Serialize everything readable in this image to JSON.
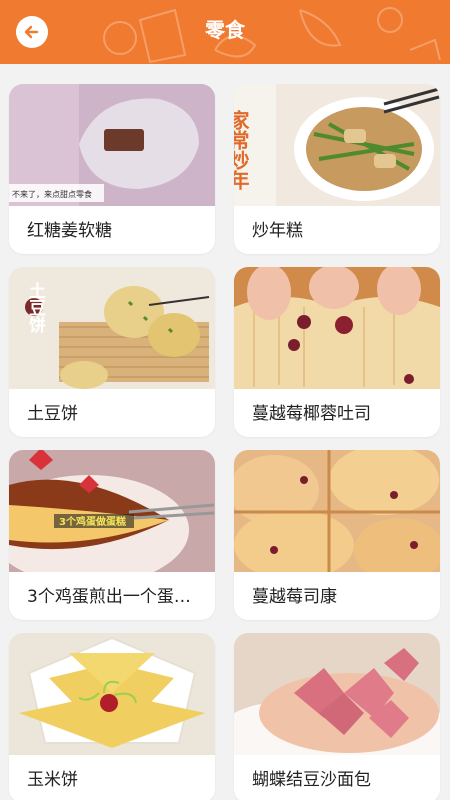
{
  "header": {
    "title": "零食",
    "back_icon": "back-arrow-icon",
    "accent_color": "#f07a30"
  },
  "recipes": [
    {
      "name": "红糖姜软糖",
      "overlay_text": "不来了，来点甜点零食"
    },
    {
      "name": "炒年糕",
      "overlay_text": "家常炒年"
    },
    {
      "name": "土豆饼",
      "overlay_text": "土豆饼"
    },
    {
      "name": "蔓越莓椰蓉吐司",
      "overlay_text": ""
    },
    {
      "name": "3个鸡蛋煎出一个蛋…",
      "overlay_text": "3个鸡蛋做蛋糕"
    },
    {
      "name": "蔓越莓司康",
      "overlay_text": ""
    },
    {
      "name": "玉米饼",
      "overlay_text": ""
    },
    {
      "name": "蝴蝶结豆沙面包",
      "overlay_text": ""
    }
  ]
}
